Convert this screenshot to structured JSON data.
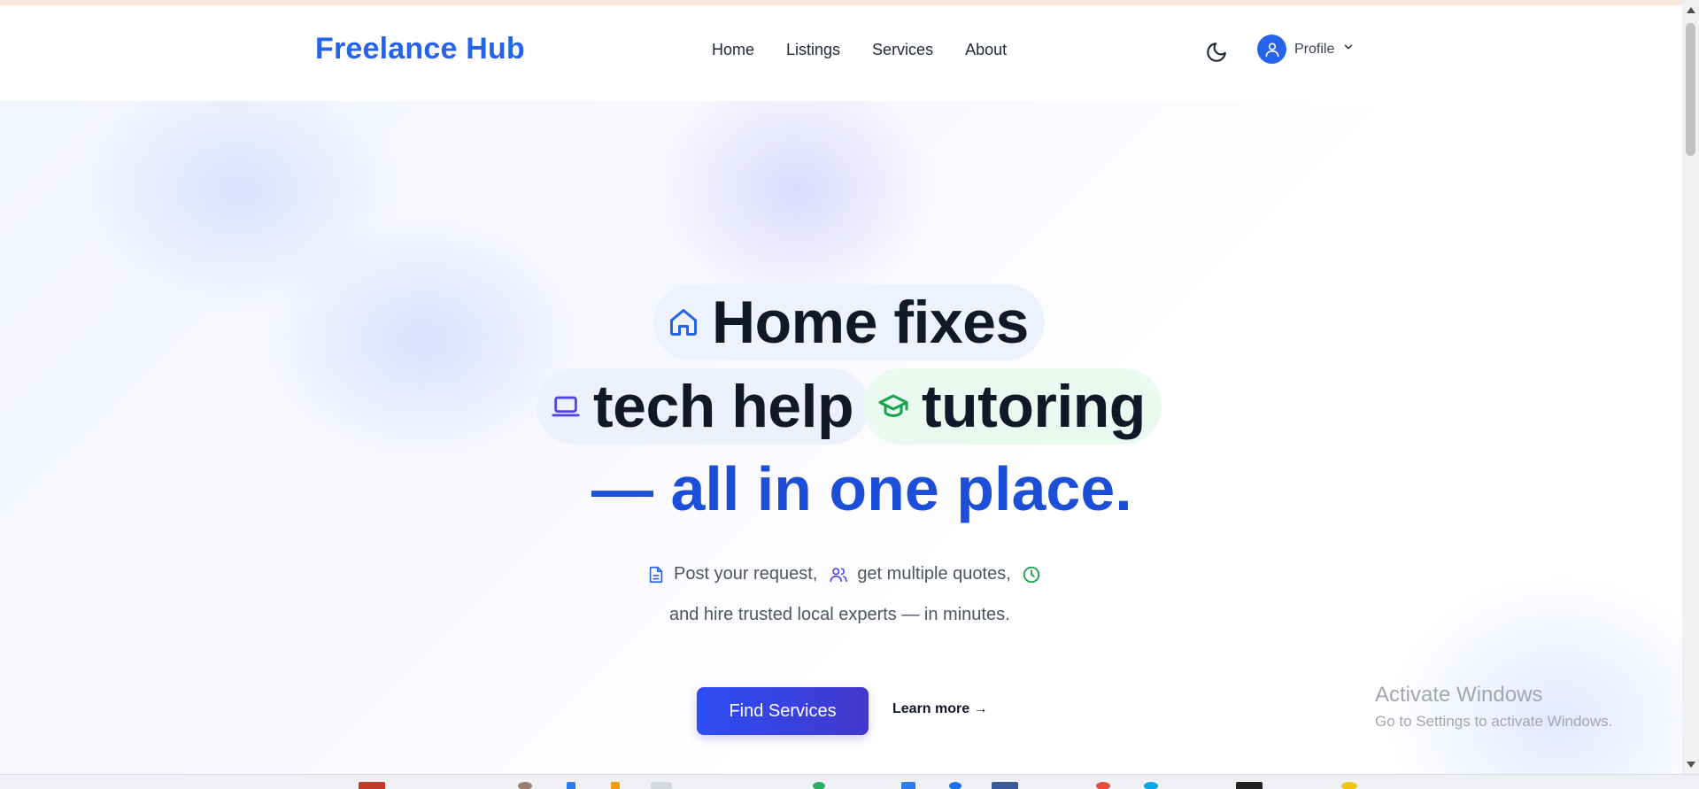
{
  "header": {
    "brand": "Freelance Hub",
    "nav": [
      "Home",
      "Listings",
      "Services",
      "About"
    ],
    "theme_icon": "moon-icon",
    "profile_label": "Profile",
    "profile_icon": "user-icon",
    "dropdown_icon": "chevron-down-icon"
  },
  "hero": {
    "pills": [
      {
        "icon": "home-icon",
        "label": "Home fixes",
        "icon_color": "#2563eb"
      },
      {
        "icon": "laptop-icon",
        "label": "tech help",
        "icon_color": "#4f46e5"
      },
      {
        "icon": "graduation-cap-icon",
        "label": "tutoring",
        "icon_color": "#16a34a"
      }
    ],
    "tagline": "— all in one place.",
    "sub_items": [
      {
        "icon": "document-icon",
        "text": "Post your request,",
        "icon_color": "#2563eb"
      },
      {
        "icon": "users-icon",
        "text": "get multiple quotes,",
        "icon_color": "#4f46e5"
      },
      {
        "icon": "clock-icon",
        "text": "",
        "icon_color": "#16a34a"
      }
    ],
    "sub_line2": "and hire trusted local experts — in minutes.",
    "primary_button": "Find Services",
    "secondary_link": "Learn more →"
  },
  "watermark": {
    "line1": "Activate Windows",
    "line2": "Go to Settings to activate Windows."
  },
  "colors": {
    "brand": "#2563eb",
    "accent": "#1d4ed8",
    "button_start": "#2c4df5",
    "button_end": "#4338ca"
  }
}
